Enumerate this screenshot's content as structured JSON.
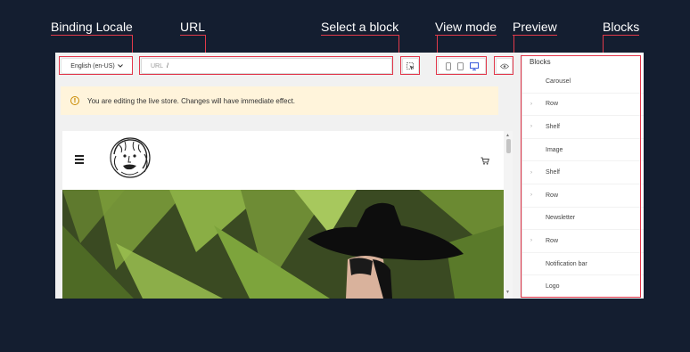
{
  "callouts": {
    "binding_locale": "Binding Locale",
    "url": "URL",
    "select_block": "Select a block",
    "view_mode": "View mode",
    "preview": "Preview",
    "blocks": "Blocks"
  },
  "toolbar": {
    "locale": "English (en-US)",
    "url_label": "URL",
    "url_value": "/"
  },
  "banner": {
    "text": "You are editing the live store. Changes will have immediate effect."
  },
  "panel": {
    "title": "Blocks",
    "items": [
      {
        "label": "Carousel",
        "expandable": false
      },
      {
        "label": "Row",
        "expandable": true
      },
      {
        "label": "Shelf",
        "expandable": true
      },
      {
        "label": "Image",
        "expandable": false
      },
      {
        "label": "Shelf",
        "expandable": true
      },
      {
        "label": "Row",
        "expandable": true
      },
      {
        "label": "Newsletter",
        "expandable": false
      },
      {
        "label": "Row",
        "expandable": true
      },
      {
        "label": "Notification bar",
        "expandable": false
      },
      {
        "label": "Logo",
        "expandable": false
      }
    ]
  },
  "colors": {
    "page_bg": "#141e30",
    "callout_line": "#e23a4a",
    "accent": "#3b5bdb",
    "banner_bg": "#fff4db",
    "warning": "#c98a00"
  }
}
